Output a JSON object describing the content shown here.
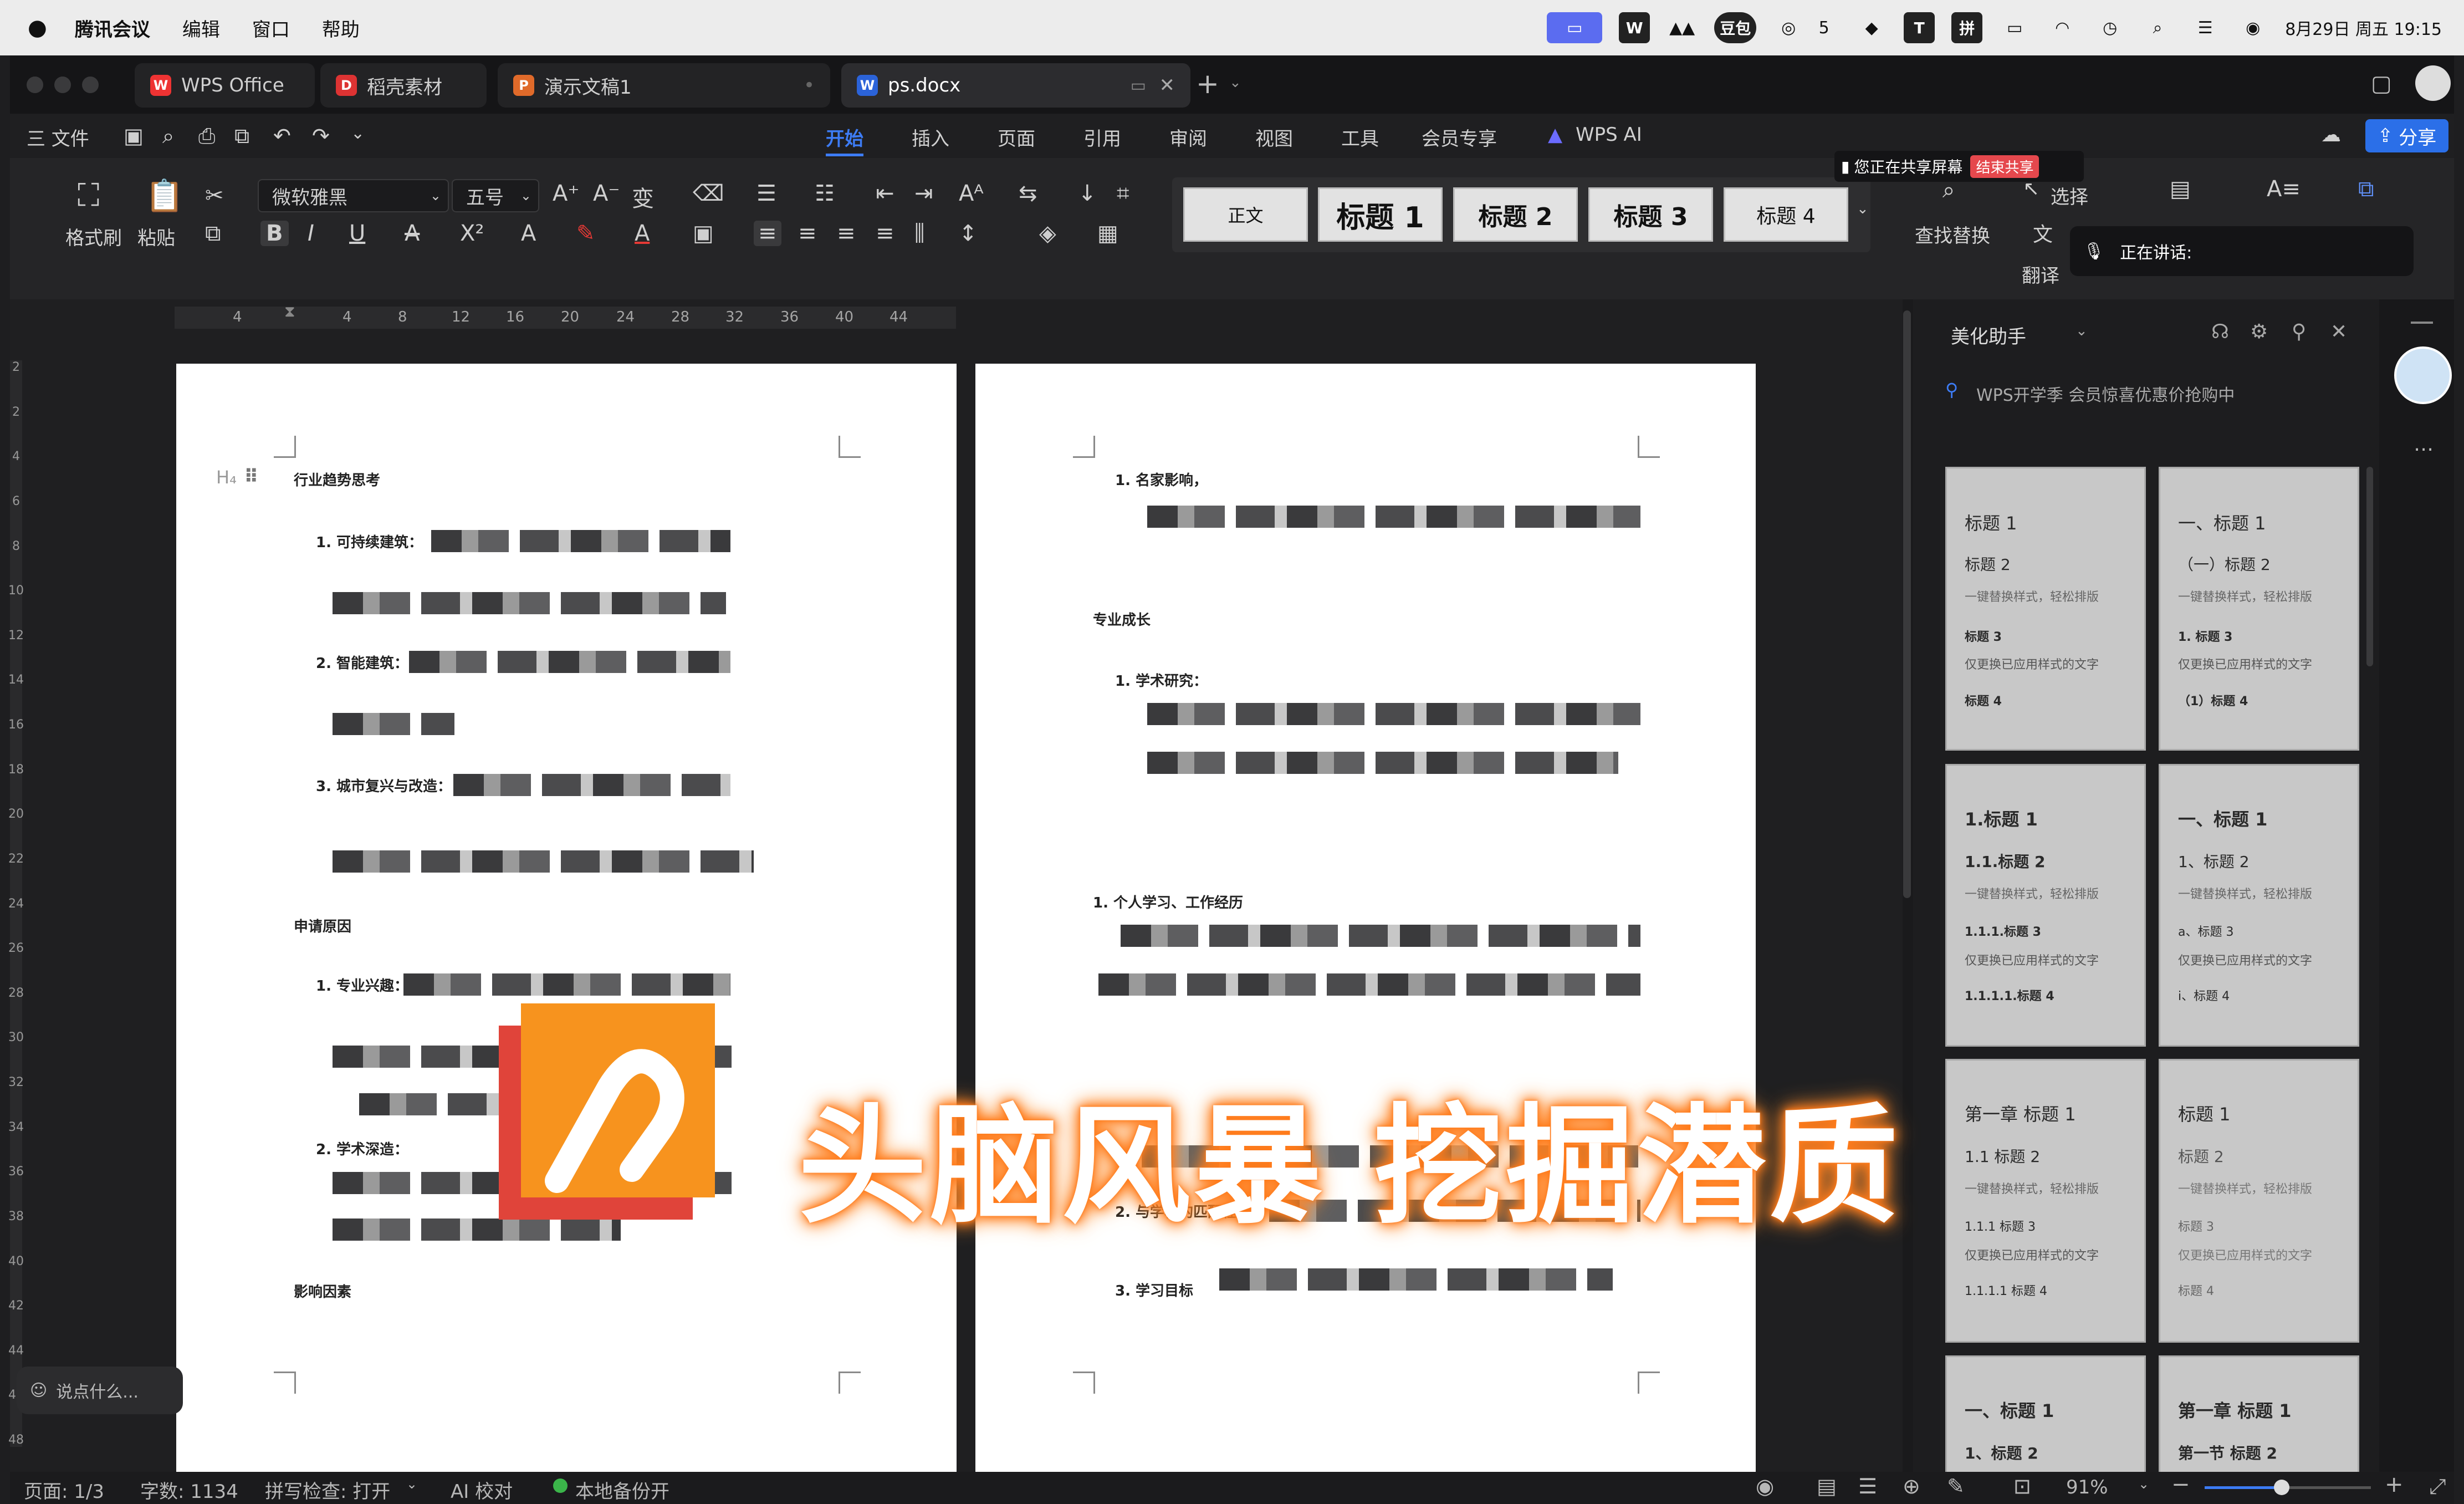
{
  "menubar": {
    "app_name": "腾讯会议",
    "items": [
      "编辑",
      "窗口",
      "帮助"
    ],
    "status_items": [
      "W",
      "豆包",
      "5",
      "T",
      "拼"
    ],
    "clock": "8月29日 周五 19:15"
  },
  "tabs": [
    {
      "label": "WPS Office",
      "icon": "W"
    },
    {
      "label": "稻壳素材",
      "icon": "D"
    },
    {
      "label": "演示文稿1",
      "icon": "P"
    },
    {
      "label": "ps.docx",
      "icon": "W"
    }
  ],
  "menu": {
    "file": "三 文件",
    "tabs": [
      "开始",
      "插入",
      "页面",
      "引用",
      "审阅",
      "视图",
      "工具",
      "会员专享",
      "WPS AI"
    ],
    "active": "开始",
    "share": "分享"
  },
  "ribbon": {
    "format_painter": "格式刷",
    "paste": "粘贴",
    "font_name": "微软雅黑",
    "font_size": "五号",
    "styles": [
      "正文",
      "标题 1",
      "标题 2",
      "标题 3",
      "标题 4"
    ],
    "find_replace": "查找替换",
    "select": "选择",
    "translate": "翻译",
    "share_notice": "您正在共享屏幕",
    "end_share": "结束共享",
    "speaking": "正在讲话:"
  },
  "ruler_ticks": [
    "4",
    "4",
    "8",
    "12",
    "16",
    "20",
    "24",
    "28",
    "32",
    "36",
    "40",
    "44"
  ],
  "vruler_ticks": [
    "2",
    "2",
    "4",
    "6",
    "8",
    "10",
    "12",
    "14",
    "16",
    "18",
    "20",
    "22",
    "24",
    "26",
    "28",
    "30",
    "32",
    "34",
    "36",
    "38",
    "40",
    "42",
    "44",
    "46",
    "48"
  ],
  "page1": {
    "heading_tag": "H₄",
    "title": "行业趋势思考",
    "items": [
      "1.  可持续建筑：",
      "2.  智能建筑：",
      "3.  城市复兴与改造："
    ],
    "section2": "申请原因",
    "items2": [
      "1.  专业兴趣：",
      "2.  学术深造："
    ],
    "section3": "影响因素"
  },
  "page2": {
    "item_top": "1.  名家影响，",
    "section": "专业成长",
    "item_research": "1.  学术研究：",
    "section2": "1.  个人学习、工作经历",
    "item_match": "2.  与学校的匹配程度：",
    "item_goal": "3.  学习目标"
  },
  "panel": {
    "title": "美化助手",
    "promo": "WPS开学季 会员惊喜优惠价抢购中",
    "cards": [
      [
        "标题 1",
        "标题 2",
        "一键替换样式，轻松排版",
        "标题 3",
        "仅更换已应用样式的文字",
        "标题 4"
      ],
      [
        "一、标题 1",
        "（一）标题 2",
        "一键替换样式，轻松排版",
        "1.  标题 3",
        "仅更换已应用样式的文字",
        "（1）标题 4"
      ],
      [
        "1.标题 1",
        "1.1.标题 2",
        "一键替换样式，轻松排版",
        "1.1.1.标题 3",
        "仅更换已应用样式的文字",
        "1.1.1.1.标题 4"
      ],
      [
        "一、标题 1",
        "1、标题 2",
        "一键替换样式，轻松排版",
        "a、标题 3",
        "仅更换已应用样式的文字",
        "i、标题 4"
      ],
      [
        "第一章  标题 1",
        "1.1 标题 2",
        "一键替换样式，轻松排版",
        "1.1.1 标题 3",
        "仅更换已应用样式的文字",
        "1.1.1.1 标题 4"
      ],
      [
        "标题 1",
        "标题 2",
        "一键替换样式，轻松排版",
        "标题 3",
        "仅更换已应用样式的文字",
        "标题 4"
      ],
      [
        "一、标题 1",
        "1、标题 2"
      ],
      [
        "第一章  标题 1",
        "第一节  标题 2"
      ]
    ]
  },
  "chat_placeholder": "说点什么...",
  "status": {
    "page": "页面: 1/3",
    "words": "字数: 1134",
    "spell": "拼写检查: 打开",
    "ai": "AI 校对",
    "backup": "本地备份开",
    "zoom": "91%"
  },
  "overlay": {
    "banner": "头脑风暴 挖掘潜质"
  },
  "colors": {
    "accent": "#3d7cf5",
    "banner_glow": "#ff7a1a",
    "logo_orange": "#f7931e",
    "logo_red": "#e0443a"
  }
}
